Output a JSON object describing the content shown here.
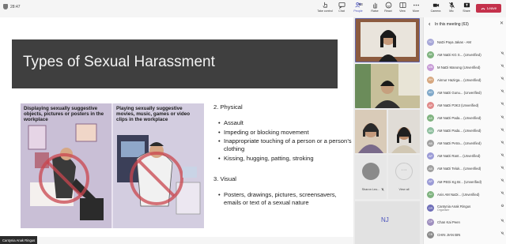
{
  "topbar": {
    "clock": "28:47",
    "buttons": [
      {
        "id": "take-control",
        "label": "Take control"
      },
      {
        "id": "chat",
        "label": "Chat"
      },
      {
        "id": "people",
        "label": "People",
        "count": "63"
      },
      {
        "id": "raise",
        "label": "Raise"
      },
      {
        "id": "react",
        "label": "React"
      },
      {
        "id": "view",
        "label": "View"
      },
      {
        "id": "more",
        "label": "More"
      },
      {
        "id": "camera",
        "label": "Camera"
      },
      {
        "id": "mic",
        "label": "Mic"
      },
      {
        "id": "share",
        "label": "Share"
      }
    ],
    "leave_label": "Leave",
    "accent_color": "#4b53bc",
    "leave_color": "#c4314b"
  },
  "slide": {
    "title": "Types of Sexual Harassment",
    "panel1_caption": "Displaying sexually suggestive objects, pictures or posters in the workplace",
    "panel2_caption": "Playing sexually suggestive movies, music, games or video clips in the workplace",
    "section1": {
      "heading": "2.    Physical",
      "items": [
        "Assault",
        "Impeding or blocking movement",
        "Inappropriate touching of a person or a person’s clothing",
        "Kissing, hugging, patting, stroking"
      ]
    },
    "section2": {
      "heading": "3.    Visual",
      "items": [
        "Posters, drawings, pictures, screensavers, emails or text of a sexual nature"
      ]
    }
  },
  "presenter": {
    "name": "Cantynia Anak Ringus"
  },
  "videos": {
    "tile5_label": "Sharon Leo...",
    "tile6_label": "View all",
    "self_initials": "NJ"
  },
  "participants": {
    "header": "In this meeting (63)",
    "list": [
      {
        "initials": "NJ",
        "name": "NaDi Paya Jakas - AM",
        "color": "#a7a7d8",
        "sub": ""
      },
      {
        "initials": "AK",
        "name": "AM NaDi KG S... (Unverified)",
        "color": "#7fb37f",
        "sub": ""
      },
      {
        "initials": "MN",
        "name": "M NaDi Manong (Unverified)",
        "color": "#c79bd6",
        "sub": ""
      },
      {
        "initials": "AH",
        "name": "Ainnur Hazirga... (Unverified)",
        "color": "#d6a77f",
        "sub": ""
      },
      {
        "initials": "AG",
        "name": "AM NaDi Gunu... (Unverified)",
        "color": "#7fa8c9",
        "sub": ""
      },
      {
        "initials": "AP",
        "name": "AM NaDi P3K3 (Unverified)",
        "color": "#e08a8a",
        "sub": ""
      },
      {
        "initials": "AS",
        "name": "AM NaDi Pada... (Unverified)",
        "color": "#7fb37f",
        "sub": ""
      },
      {
        "initials": "AN",
        "name": "AM NaDi Pada... (Unverified)",
        "color": "#8fbf9f",
        "sub": ""
      },
      {
        "initials": "AB",
        "name": "AM NaDi Petra... (Unverified)",
        "color": "#a0a0a0",
        "sub": ""
      },
      {
        "initials": "AP",
        "name": "AM NaDi Rant... (Unverified)",
        "color": "#9b9bd6",
        "sub": ""
      },
      {
        "initials": "AB",
        "name": "AM NaDi Teluk... (Unverified)",
        "color": "#a0a0a0",
        "sub": ""
      },
      {
        "initials": "AP",
        "name": "AM PEDi Kg Br... (Unverified)",
        "color": "#9b9bd6",
        "sub": ""
      },
      {
        "initials": "AJ",
        "name": "Anis AM NaDi... (Unverified)",
        "color": "#7fb37f",
        "sub": ""
      },
      {
        "initials": "CR",
        "name": "Cantynia Anak Ringus",
        "color": "#6f6fb8",
        "sub": "Organiser"
      },
      {
        "initials": "CP",
        "name": "Chan Kai Peen",
        "color": "#9f8fbf",
        "sub": ""
      },
      {
        "initials": "CB",
        "name": "CHIN JIAN BIN",
        "color": "#8a8a8a",
        "sub": ""
      }
    ]
  }
}
